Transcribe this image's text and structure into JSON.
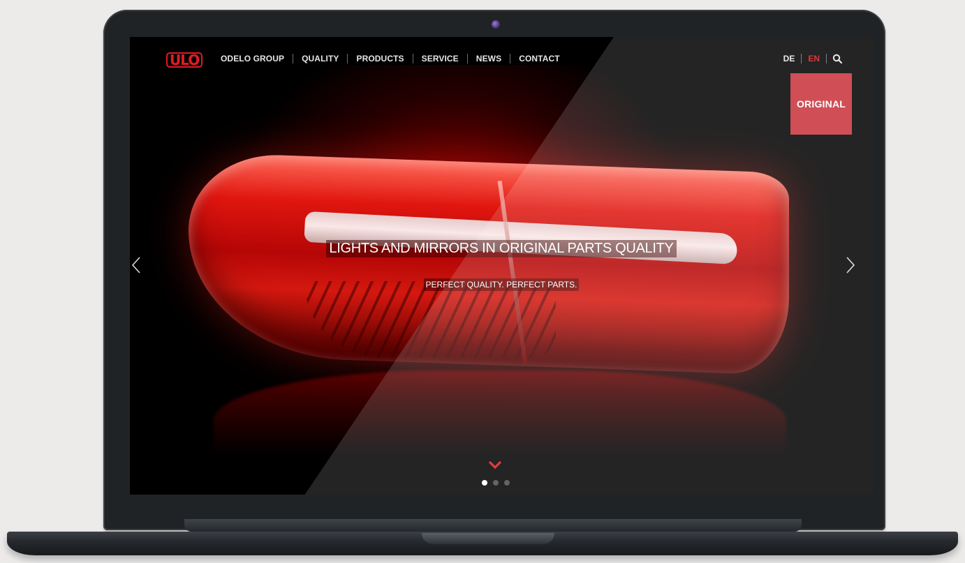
{
  "brand": {
    "logo_text": "ULO",
    "accent_color": "#d11a20"
  },
  "nav": {
    "items": [
      {
        "label": "ODELO GROUP"
      },
      {
        "label": "QUALITY"
      },
      {
        "label": "PRODUCTS"
      },
      {
        "label": "SERVICE"
      },
      {
        "label": "NEWS"
      },
      {
        "label": "CONTACT"
      }
    ]
  },
  "languages": {
    "de": "DE",
    "en": "EN",
    "active": "EN"
  },
  "search": {
    "icon": "search-icon"
  },
  "badge": {
    "label": "ORIGINAL",
    "color": "#c8323a"
  },
  "hero": {
    "headline": "LIGHTS AND MIRRORS IN ORIGINAL PARTS QUALITY",
    "subline": "PERFECT QUALITY. PERFECT PARTS.",
    "prev_icon": "chevron-left-icon",
    "next_icon": "chevron-right-icon",
    "scroll_icon": "chevron-down-icon"
  },
  "slider": {
    "total": 3,
    "active_index": 0
  }
}
